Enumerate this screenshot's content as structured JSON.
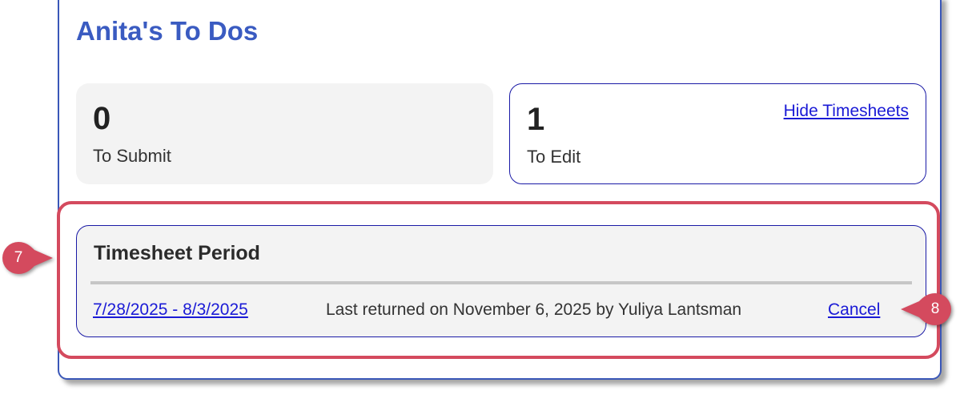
{
  "title": "Anita's To Dos",
  "cards": {
    "submit": {
      "count": "0",
      "label": "To Submit"
    },
    "edit": {
      "count": "1",
      "label": "To Edit",
      "link": "Hide Timesheets"
    }
  },
  "period": {
    "heading": "Timesheet Period",
    "row": {
      "date_range": "7/28/2025 - 8/3/2025",
      "status": "Last returned on November 6, 2025 by Yuliya Lantsman",
      "action": "Cancel"
    }
  },
  "callouts": {
    "step7": "7",
    "step8": "8"
  },
  "colors": {
    "title": "#3a5bc1",
    "panel_border": "#3a57b8",
    "link": "#1a1ad6",
    "highlight": "#d44a5e",
    "callout": "#d44a5e"
  }
}
